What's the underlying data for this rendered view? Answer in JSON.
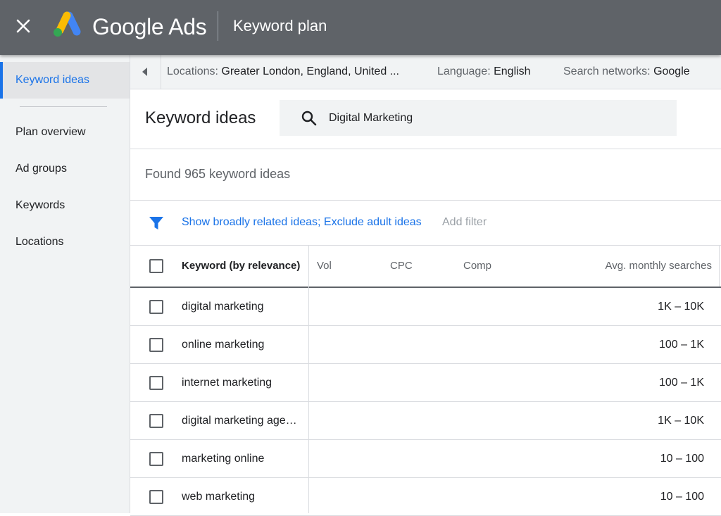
{
  "topbar": {
    "product_name": "Google Ads",
    "tool_title": "Keyword plan",
    "colors": {
      "bar": "#5f6368",
      "logo_blue": "#4285f4",
      "logo_yellow": "#fbbc04",
      "logo_green": "#34a853"
    }
  },
  "sidebar": {
    "items": [
      {
        "label": "Keyword ideas",
        "active": true
      },
      {
        "label": "Plan overview"
      },
      {
        "label": "Ad groups"
      },
      {
        "label": "Keywords"
      },
      {
        "label": "Locations"
      }
    ]
  },
  "filters": {
    "locations_key": "Locations:",
    "locations_value": "Greater London, England, United ...",
    "language_key": "Language:",
    "language_value": "English",
    "networks_key": "Search networks:",
    "networks_value": "Google"
  },
  "main": {
    "title": "Keyword ideas",
    "search_value": "Digital Marketing",
    "found_text": "Found 965 keyword ideas",
    "filter_link": "Show broadly related ideas; Exclude adult ideas",
    "add_filter": "Add filter"
  },
  "table": {
    "headers": {
      "keyword": "Keyword (by relevance)",
      "vol": "Vol",
      "cpc": "CPC",
      "comp": "Comp",
      "avg": "Avg. monthly searches"
    },
    "rows": [
      {
        "keyword": "digital marketing",
        "avg": "1K – 10K"
      },
      {
        "keyword": "online marketing",
        "avg": "100 – 1K"
      },
      {
        "keyword": "internet marketing",
        "avg": "100 – 1K"
      },
      {
        "keyword": "digital marketing agency",
        "avg": "1K – 10K"
      },
      {
        "keyword": "marketing online",
        "avg": "10 – 100"
      },
      {
        "keyword": "web marketing",
        "avg": "10 – 100"
      }
    ]
  },
  "colors": {
    "accent": "#1a73e8",
    "text": "#202124",
    "muted": "#5f6368"
  }
}
